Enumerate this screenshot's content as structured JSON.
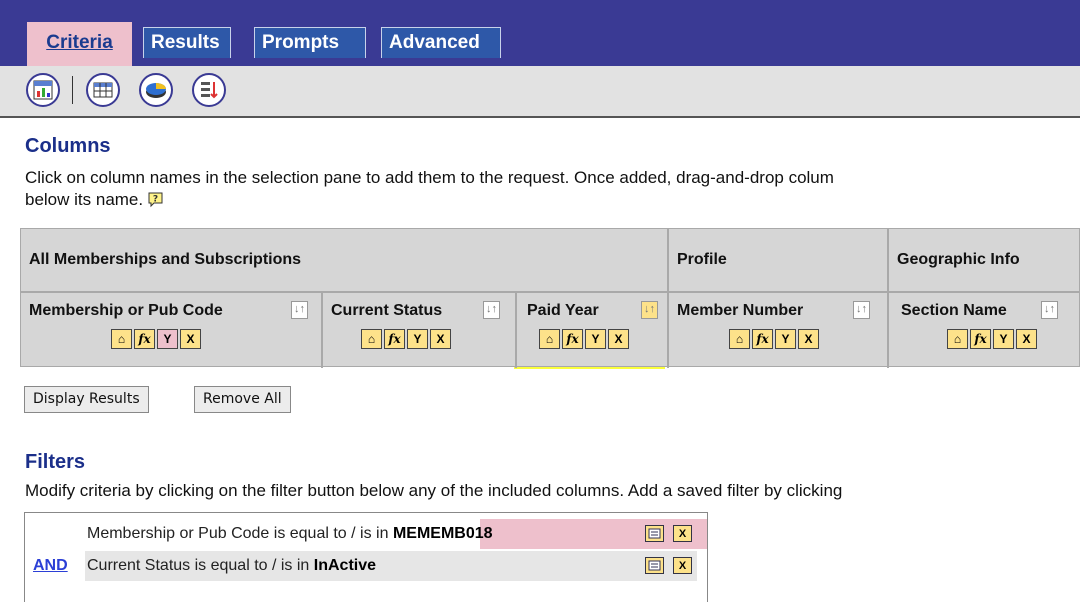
{
  "tabs": [
    {
      "label": "Criteria",
      "active": true
    },
    {
      "label": "Results",
      "active": false
    },
    {
      "label": "Prompts",
      "active": false
    },
    {
      "label": "Advanced",
      "active": false
    }
  ],
  "toolbar": {
    "icons": [
      "chart-report-icon",
      "table-view-icon",
      "pie-chart-icon",
      "sort-order-icon"
    ]
  },
  "columns": {
    "title": "Columns",
    "description_line1": "Click on column names in the selection pane to add them to the request. Once added, drag-and-drop colum",
    "description_line2": "below its name.",
    "groups": [
      {
        "label": "All Memberships and Subscriptions"
      },
      {
        "label": "Profile"
      },
      {
        "label": "Geographic Info"
      }
    ],
    "items": [
      {
        "label": "Membership or Pub Code",
        "filter_active": true
      },
      {
        "label": "Current Status",
        "filter_active": false
      },
      {
        "label": "Paid Year",
        "highlighted": true
      },
      {
        "label": "Member Number",
        "filter_active": false
      },
      {
        "label": "Section Name",
        "filter_active": false
      }
    ],
    "sort_glyph": "↓↑",
    "icon_glyphs": {
      "properties": "⌂",
      "formula": "fx",
      "filter": "Y",
      "delete": "X"
    }
  },
  "buttons": {
    "display_results": "Display Results",
    "remove_all": "Remove All"
  },
  "filters": {
    "title": "Filters",
    "description": "Modify criteria by clicking on the filter button below any of the included columns. Add a saved filter by clicking",
    "rows": [
      {
        "conjunction": "",
        "text": "Membership or Pub Code is equal to / is in",
        "value": "MEMEMB018",
        "highlighted": true
      },
      {
        "conjunction": "AND",
        "text": "Current Status is equal to / is in",
        "value": "InActive",
        "highlighted": false
      }
    ]
  },
  "colors": {
    "topbar": "#3a3a94",
    "active_tab": "#eec0cc",
    "highlight_yellow": "#fbff3b",
    "heading_blue": "#1b2f8a"
  }
}
